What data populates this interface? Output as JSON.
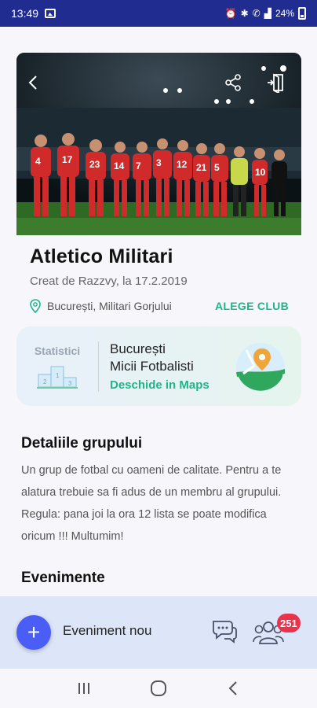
{
  "status_bar": {
    "time": "13:49",
    "battery": "24%"
  },
  "club": {
    "name": "Atletico Militari",
    "created": "Creat de Razzvy, la 17.2.2019",
    "location": "București, Militari Gorjului",
    "choose_button": "ALEGE CLUB"
  },
  "map_card": {
    "stats_label": "Statistici",
    "city": "București",
    "venue": "Micii Fotbalisti",
    "open_maps": "Deschide in Maps"
  },
  "details": {
    "title": "Detaliile grupului",
    "text": "Un grup de fotbal cu oameni de calitate. Pentru a te alatura trebuie sa fi adus de un membru al grupului. Regula: pana joi la ora 12 lista se poate modifica oricum !!! Multumim!"
  },
  "events": {
    "title": "Evenimente"
  },
  "bottom_bar": {
    "new_event": "Eveniment nou",
    "members_count": "251"
  },
  "colors": {
    "status_bar": "#202c8f",
    "accent_green": "#1fb58a",
    "fab": "#4a5ef5",
    "badge": "#e8334a"
  }
}
